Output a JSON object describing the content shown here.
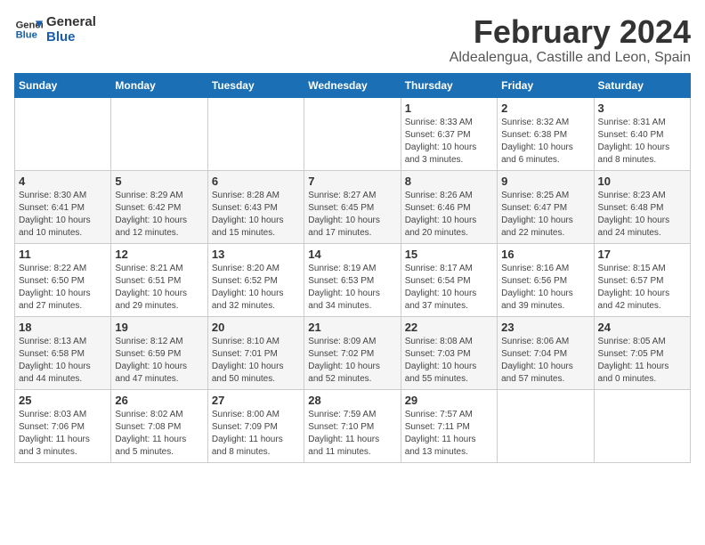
{
  "logo": {
    "line1": "General",
    "line2": "Blue"
  },
  "title": "February 2024",
  "subtitle": "Aldealengua, Castille and Leon, Spain",
  "weekdays": [
    "Sunday",
    "Monday",
    "Tuesday",
    "Wednesday",
    "Thursday",
    "Friday",
    "Saturday"
  ],
  "weeks": [
    [
      {
        "day": "",
        "info": ""
      },
      {
        "day": "",
        "info": ""
      },
      {
        "day": "",
        "info": ""
      },
      {
        "day": "",
        "info": ""
      },
      {
        "day": "1",
        "info": "Sunrise: 8:33 AM\nSunset: 6:37 PM\nDaylight: 10 hours\nand 3 minutes."
      },
      {
        "day": "2",
        "info": "Sunrise: 8:32 AM\nSunset: 6:38 PM\nDaylight: 10 hours\nand 6 minutes."
      },
      {
        "day": "3",
        "info": "Sunrise: 8:31 AM\nSunset: 6:40 PM\nDaylight: 10 hours\nand 8 minutes."
      }
    ],
    [
      {
        "day": "4",
        "info": "Sunrise: 8:30 AM\nSunset: 6:41 PM\nDaylight: 10 hours\nand 10 minutes."
      },
      {
        "day": "5",
        "info": "Sunrise: 8:29 AM\nSunset: 6:42 PM\nDaylight: 10 hours\nand 12 minutes."
      },
      {
        "day": "6",
        "info": "Sunrise: 8:28 AM\nSunset: 6:43 PM\nDaylight: 10 hours\nand 15 minutes."
      },
      {
        "day": "7",
        "info": "Sunrise: 8:27 AM\nSunset: 6:45 PM\nDaylight: 10 hours\nand 17 minutes."
      },
      {
        "day": "8",
        "info": "Sunrise: 8:26 AM\nSunset: 6:46 PM\nDaylight: 10 hours\nand 20 minutes."
      },
      {
        "day": "9",
        "info": "Sunrise: 8:25 AM\nSunset: 6:47 PM\nDaylight: 10 hours\nand 22 minutes."
      },
      {
        "day": "10",
        "info": "Sunrise: 8:23 AM\nSunset: 6:48 PM\nDaylight: 10 hours\nand 24 minutes."
      }
    ],
    [
      {
        "day": "11",
        "info": "Sunrise: 8:22 AM\nSunset: 6:50 PM\nDaylight: 10 hours\nand 27 minutes."
      },
      {
        "day": "12",
        "info": "Sunrise: 8:21 AM\nSunset: 6:51 PM\nDaylight: 10 hours\nand 29 minutes."
      },
      {
        "day": "13",
        "info": "Sunrise: 8:20 AM\nSunset: 6:52 PM\nDaylight: 10 hours\nand 32 minutes."
      },
      {
        "day": "14",
        "info": "Sunrise: 8:19 AM\nSunset: 6:53 PM\nDaylight: 10 hours\nand 34 minutes."
      },
      {
        "day": "15",
        "info": "Sunrise: 8:17 AM\nSunset: 6:54 PM\nDaylight: 10 hours\nand 37 minutes."
      },
      {
        "day": "16",
        "info": "Sunrise: 8:16 AM\nSunset: 6:56 PM\nDaylight: 10 hours\nand 39 minutes."
      },
      {
        "day": "17",
        "info": "Sunrise: 8:15 AM\nSunset: 6:57 PM\nDaylight: 10 hours\nand 42 minutes."
      }
    ],
    [
      {
        "day": "18",
        "info": "Sunrise: 8:13 AM\nSunset: 6:58 PM\nDaylight: 10 hours\nand 44 minutes."
      },
      {
        "day": "19",
        "info": "Sunrise: 8:12 AM\nSunset: 6:59 PM\nDaylight: 10 hours\nand 47 minutes."
      },
      {
        "day": "20",
        "info": "Sunrise: 8:10 AM\nSunset: 7:01 PM\nDaylight: 10 hours\nand 50 minutes."
      },
      {
        "day": "21",
        "info": "Sunrise: 8:09 AM\nSunset: 7:02 PM\nDaylight: 10 hours\nand 52 minutes."
      },
      {
        "day": "22",
        "info": "Sunrise: 8:08 AM\nSunset: 7:03 PM\nDaylight: 10 hours\nand 55 minutes."
      },
      {
        "day": "23",
        "info": "Sunrise: 8:06 AM\nSunset: 7:04 PM\nDaylight: 10 hours\nand 57 minutes."
      },
      {
        "day": "24",
        "info": "Sunrise: 8:05 AM\nSunset: 7:05 PM\nDaylight: 11 hours\nand 0 minutes."
      }
    ],
    [
      {
        "day": "25",
        "info": "Sunrise: 8:03 AM\nSunset: 7:06 PM\nDaylight: 11 hours\nand 3 minutes."
      },
      {
        "day": "26",
        "info": "Sunrise: 8:02 AM\nSunset: 7:08 PM\nDaylight: 11 hours\nand 5 minutes."
      },
      {
        "day": "27",
        "info": "Sunrise: 8:00 AM\nSunset: 7:09 PM\nDaylight: 11 hours\nand 8 minutes."
      },
      {
        "day": "28",
        "info": "Sunrise: 7:59 AM\nSunset: 7:10 PM\nDaylight: 11 hours\nand 11 minutes."
      },
      {
        "day": "29",
        "info": "Sunrise: 7:57 AM\nSunset: 7:11 PM\nDaylight: 11 hours\nand 13 minutes."
      },
      {
        "day": "",
        "info": ""
      },
      {
        "day": "",
        "info": ""
      }
    ]
  ]
}
